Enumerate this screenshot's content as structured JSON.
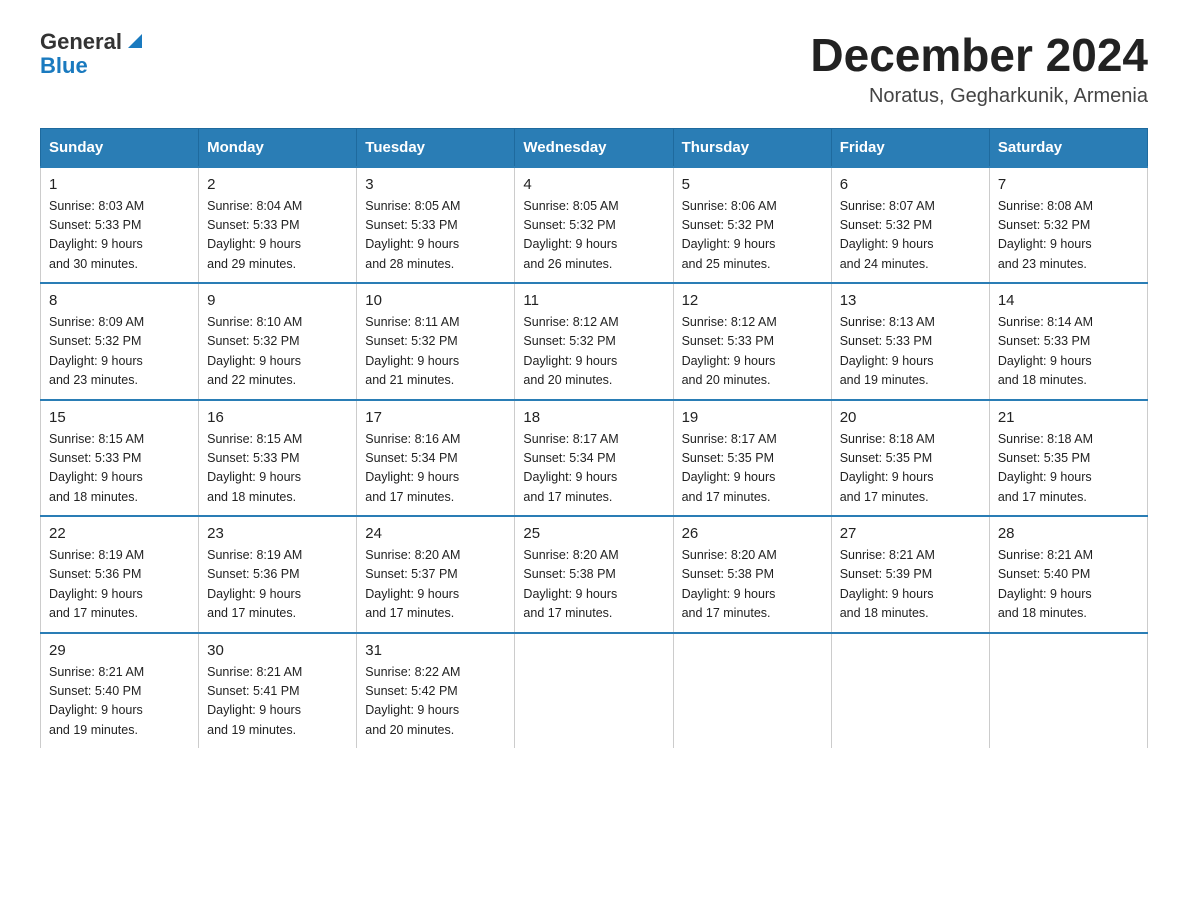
{
  "header": {
    "logo_general": "General",
    "logo_blue": "Blue",
    "month_title": "December 2024",
    "location": "Noratus, Gegharkunik, Armenia"
  },
  "columns": [
    "Sunday",
    "Monday",
    "Tuesday",
    "Wednesday",
    "Thursday",
    "Friday",
    "Saturday"
  ],
  "weeks": [
    [
      {
        "day": "1",
        "sunrise": "8:03 AM",
        "sunset": "5:33 PM",
        "daylight": "9 hours and 30 minutes."
      },
      {
        "day": "2",
        "sunrise": "8:04 AM",
        "sunset": "5:33 PM",
        "daylight": "9 hours and 29 minutes."
      },
      {
        "day": "3",
        "sunrise": "8:05 AM",
        "sunset": "5:33 PM",
        "daylight": "9 hours and 28 minutes."
      },
      {
        "day": "4",
        "sunrise": "8:05 AM",
        "sunset": "5:32 PM",
        "daylight": "9 hours and 26 minutes."
      },
      {
        "day": "5",
        "sunrise": "8:06 AM",
        "sunset": "5:32 PM",
        "daylight": "9 hours and 25 minutes."
      },
      {
        "day": "6",
        "sunrise": "8:07 AM",
        "sunset": "5:32 PM",
        "daylight": "9 hours and 24 minutes."
      },
      {
        "day": "7",
        "sunrise": "8:08 AM",
        "sunset": "5:32 PM",
        "daylight": "9 hours and 23 minutes."
      }
    ],
    [
      {
        "day": "8",
        "sunrise": "8:09 AM",
        "sunset": "5:32 PM",
        "daylight": "9 hours and 23 minutes."
      },
      {
        "day": "9",
        "sunrise": "8:10 AM",
        "sunset": "5:32 PM",
        "daylight": "9 hours and 22 minutes."
      },
      {
        "day": "10",
        "sunrise": "8:11 AM",
        "sunset": "5:32 PM",
        "daylight": "9 hours and 21 minutes."
      },
      {
        "day": "11",
        "sunrise": "8:12 AM",
        "sunset": "5:32 PM",
        "daylight": "9 hours and 20 minutes."
      },
      {
        "day": "12",
        "sunrise": "8:12 AM",
        "sunset": "5:33 PM",
        "daylight": "9 hours and 20 minutes."
      },
      {
        "day": "13",
        "sunrise": "8:13 AM",
        "sunset": "5:33 PM",
        "daylight": "9 hours and 19 minutes."
      },
      {
        "day": "14",
        "sunrise": "8:14 AM",
        "sunset": "5:33 PM",
        "daylight": "9 hours and 18 minutes."
      }
    ],
    [
      {
        "day": "15",
        "sunrise": "8:15 AM",
        "sunset": "5:33 PM",
        "daylight": "9 hours and 18 minutes."
      },
      {
        "day": "16",
        "sunrise": "8:15 AM",
        "sunset": "5:33 PM",
        "daylight": "9 hours and 18 minutes."
      },
      {
        "day": "17",
        "sunrise": "8:16 AM",
        "sunset": "5:34 PM",
        "daylight": "9 hours and 17 minutes."
      },
      {
        "day": "18",
        "sunrise": "8:17 AM",
        "sunset": "5:34 PM",
        "daylight": "9 hours and 17 minutes."
      },
      {
        "day": "19",
        "sunrise": "8:17 AM",
        "sunset": "5:35 PM",
        "daylight": "9 hours and 17 minutes."
      },
      {
        "day": "20",
        "sunrise": "8:18 AM",
        "sunset": "5:35 PM",
        "daylight": "9 hours and 17 minutes."
      },
      {
        "day": "21",
        "sunrise": "8:18 AM",
        "sunset": "5:35 PM",
        "daylight": "9 hours and 17 minutes."
      }
    ],
    [
      {
        "day": "22",
        "sunrise": "8:19 AM",
        "sunset": "5:36 PM",
        "daylight": "9 hours and 17 minutes."
      },
      {
        "day": "23",
        "sunrise": "8:19 AM",
        "sunset": "5:36 PM",
        "daylight": "9 hours and 17 minutes."
      },
      {
        "day": "24",
        "sunrise": "8:20 AM",
        "sunset": "5:37 PM",
        "daylight": "9 hours and 17 minutes."
      },
      {
        "day": "25",
        "sunrise": "8:20 AM",
        "sunset": "5:38 PM",
        "daylight": "9 hours and 17 minutes."
      },
      {
        "day": "26",
        "sunrise": "8:20 AM",
        "sunset": "5:38 PM",
        "daylight": "9 hours and 17 minutes."
      },
      {
        "day": "27",
        "sunrise": "8:21 AM",
        "sunset": "5:39 PM",
        "daylight": "9 hours and 18 minutes."
      },
      {
        "day": "28",
        "sunrise": "8:21 AM",
        "sunset": "5:40 PM",
        "daylight": "9 hours and 18 minutes."
      }
    ],
    [
      {
        "day": "29",
        "sunrise": "8:21 AM",
        "sunset": "5:40 PM",
        "daylight": "9 hours and 19 minutes."
      },
      {
        "day": "30",
        "sunrise": "8:21 AM",
        "sunset": "5:41 PM",
        "daylight": "9 hours and 19 minutes."
      },
      {
        "day": "31",
        "sunrise": "8:22 AM",
        "sunset": "5:42 PM",
        "daylight": "9 hours and 20 minutes."
      },
      null,
      null,
      null,
      null
    ]
  ],
  "labels": {
    "sunrise_prefix": "Sunrise: ",
    "sunset_prefix": "Sunset: ",
    "daylight_prefix": "Daylight: "
  }
}
